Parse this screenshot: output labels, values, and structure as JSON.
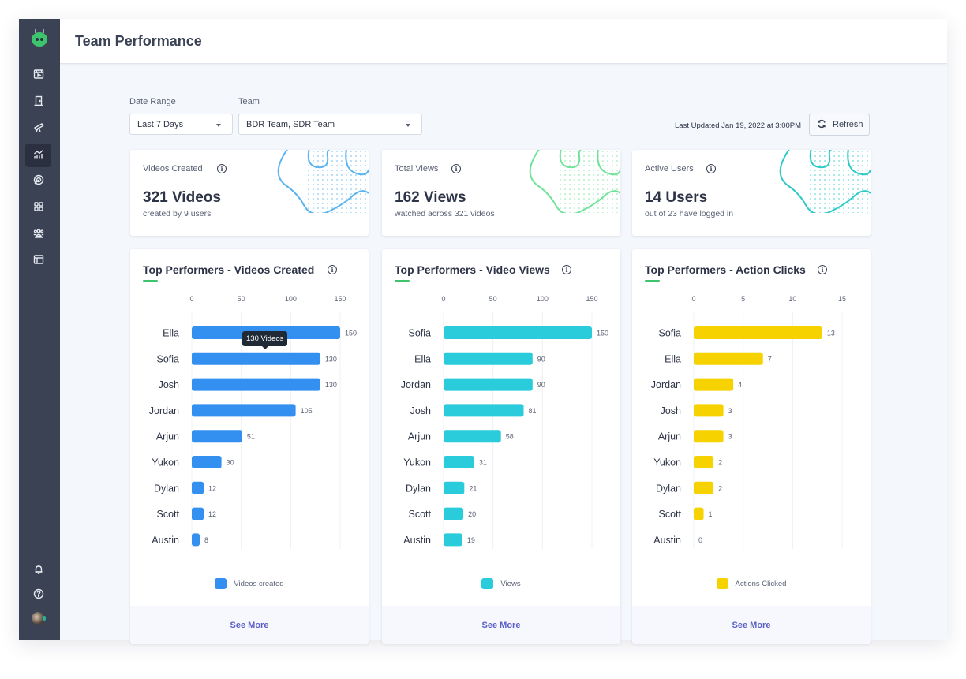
{
  "header": {
    "title": "Team Performance"
  },
  "sidebar": {
    "items": [
      {
        "icon": "video-clapper-icon",
        "label": "Videos"
      },
      {
        "icon": "door-icon",
        "label": "Rooms"
      },
      {
        "icon": "telescope-icon",
        "label": "Discover"
      },
      {
        "icon": "analytics-icon",
        "label": "Analytics",
        "active": true
      },
      {
        "icon": "target-icon",
        "label": "Campaigns"
      },
      {
        "icon": "grid-icon",
        "label": "Apps"
      },
      {
        "icon": "team-icon",
        "label": "Team"
      },
      {
        "icon": "layout-icon",
        "label": "Templates"
      }
    ],
    "bottom": [
      {
        "icon": "bell-icon",
        "label": "Notifications"
      },
      {
        "icon": "help-icon",
        "label": "Help"
      },
      {
        "icon": "avatar",
        "label": "Profile"
      }
    ]
  },
  "filters": {
    "date_range": {
      "label": "Date Range",
      "value": "Last 7 Days"
    },
    "team": {
      "label": "Team",
      "value": "BDR Team, SDR Team"
    }
  },
  "last_updated": "Last Updated Jan 19, 2022 at 3:00PM",
  "refresh_label": "Refresh",
  "stats": [
    {
      "label": "Videos Created",
      "value": "321 Videos",
      "sub": "created by 9 users",
      "accent": "#5bb4ee"
    },
    {
      "label": "Total Views",
      "value": "162 Views",
      "sub": "watched across 321 videos",
      "accent": "#6fe39a"
    },
    {
      "label": "Active Users",
      "value": "14 Users",
      "sub": "out of 23 have logged in",
      "accent": "#2ec9c9"
    }
  ],
  "see_more_label": "See More",
  "tooltip": {
    "text": "130 Videos"
  },
  "chart_data": [
    {
      "type": "bar",
      "orientation": "horizontal",
      "title": "Top Performers - Videos Created",
      "categories": [
        "Ella",
        "Sofia",
        "Josh",
        "Jordan",
        "Arjun",
        "Yukon",
        "Dylan",
        "Scott",
        "Austin"
      ],
      "values": [
        150,
        130,
        130,
        105,
        51,
        30,
        12,
        12,
        8
      ],
      "xticks": [
        0,
        50,
        100,
        150
      ],
      "xlim": [
        0,
        150
      ],
      "legend": "Videos created",
      "legend_position": "bottom",
      "color": "#3390f0",
      "grid": true
    },
    {
      "type": "bar",
      "orientation": "horizontal",
      "title": "Top Performers - Video Views",
      "categories": [
        "Sofia",
        "Ella",
        "Jordan",
        "Josh",
        "Arjun",
        "Yukon",
        "Dylan",
        "Scott",
        "Austin"
      ],
      "values": [
        150,
        90,
        90,
        81,
        58,
        31,
        21,
        20,
        19
      ],
      "xticks": [
        0,
        50,
        100,
        150
      ],
      "xlim": [
        0,
        150
      ],
      "legend": "Views",
      "legend_position": "bottom",
      "color": "#2acbdb",
      "grid": true
    },
    {
      "type": "bar",
      "orientation": "horizontal",
      "title": "Top Performers - Action Clicks",
      "categories": [
        "Sofia",
        "Ella",
        "Jordan",
        "Josh",
        "Arjun",
        "Yukon",
        "Dylan",
        "Scott",
        "Austin"
      ],
      "values": [
        13,
        7,
        4,
        3,
        3,
        2,
        2,
        1,
        0
      ],
      "xticks": [
        0,
        5,
        10,
        15
      ],
      "xlim": [
        0,
        15
      ],
      "legend": "Actions Clicked",
      "legend_position": "bottom",
      "color": "#f5d200",
      "grid": true
    }
  ]
}
